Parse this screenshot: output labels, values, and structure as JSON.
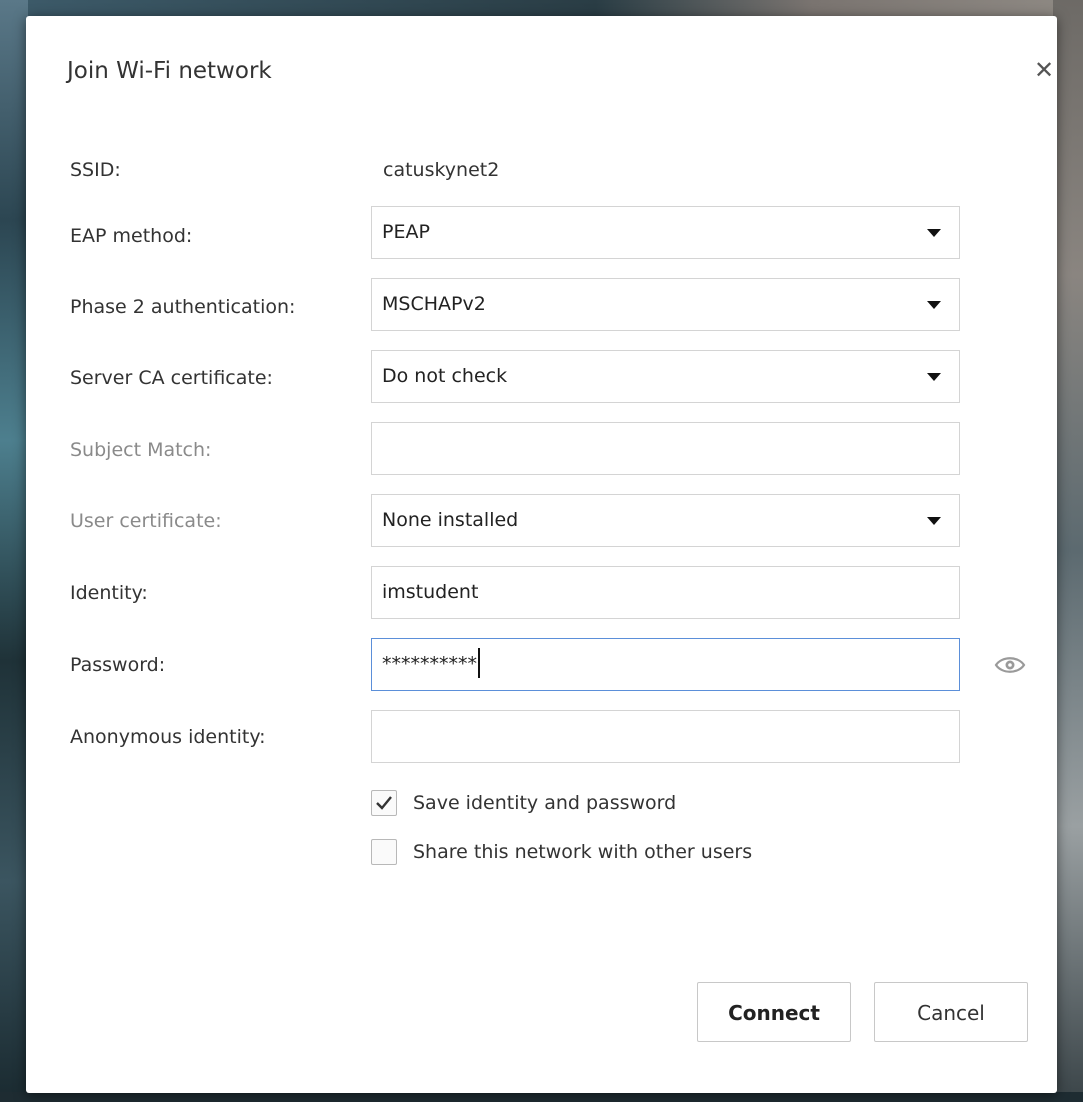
{
  "dialog": {
    "title": "Join Wi-Fi network",
    "close_icon": "close-icon"
  },
  "form": {
    "ssid_label": "SSID:",
    "ssid_value": "catuskynet2",
    "eap_label": "EAP method:",
    "eap_value": "PEAP",
    "phase2_label": "Phase 2 authentication:",
    "phase2_value": "MSCHAPv2",
    "server_ca_label": "Server CA certificate:",
    "server_ca_value": "Do not check",
    "subject_match_label": "Subject Match:",
    "subject_match_value": "",
    "user_cert_label": "User certificate:",
    "user_cert_value": "None installed",
    "identity_label": "Identity:",
    "identity_value": "imstudent",
    "password_label": "Password:",
    "password_value": "**********",
    "anonymous_label": "Anonymous identity:",
    "anonymous_value": ""
  },
  "options": {
    "save_label": "Save identity and password",
    "save_checked": true,
    "share_label": "Share this network with other users",
    "share_checked": false
  },
  "buttons": {
    "connect": "Connect",
    "cancel": "Cancel"
  },
  "colors": {
    "focus_border": "#5b8fd9",
    "disabled_label": "#8a8a8a"
  }
}
